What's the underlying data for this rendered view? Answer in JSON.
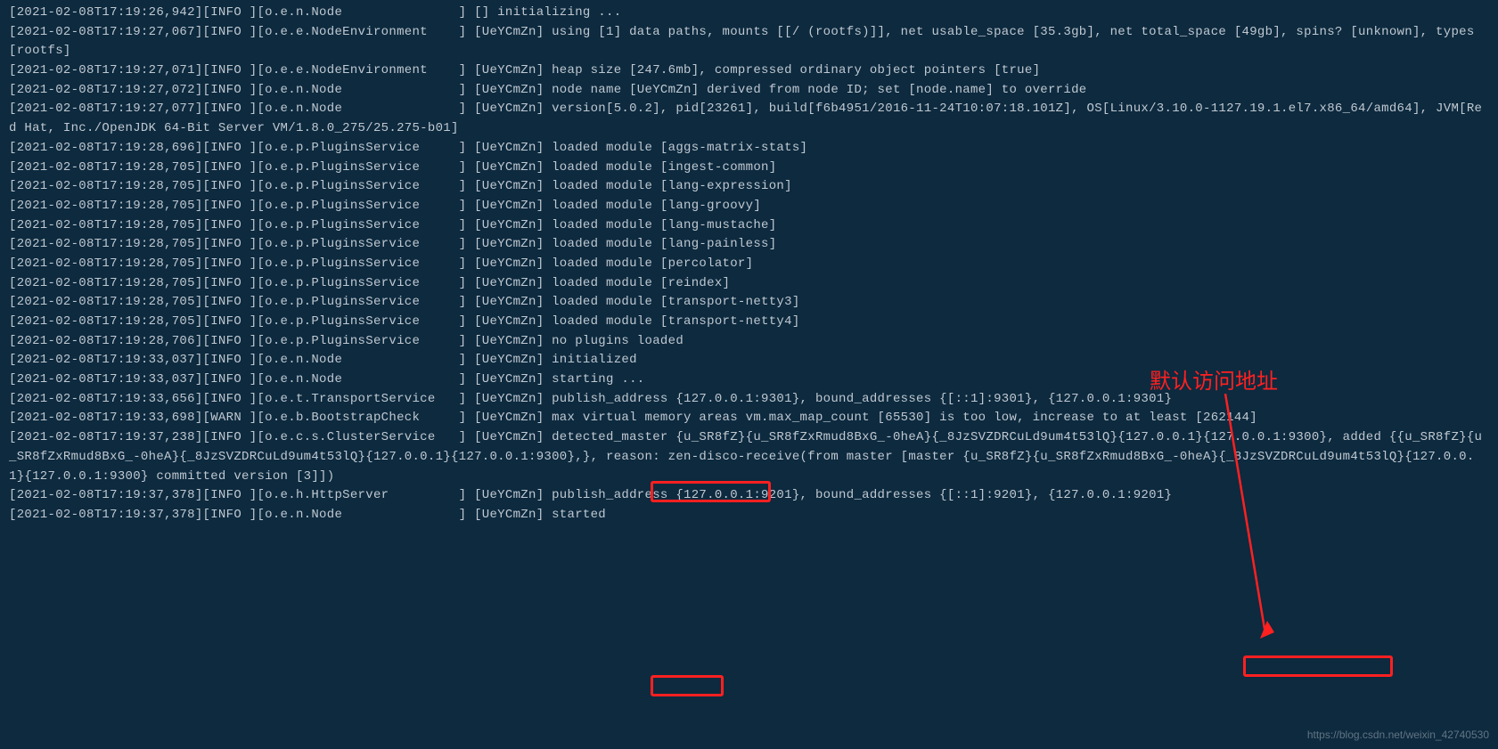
{
  "log_lines": [
    "[2021-02-08T17:19:26,942][INFO ][o.e.n.Node               ] [] initializing ...",
    "[2021-02-08T17:19:27,067][INFO ][o.e.e.NodeEnvironment    ] [UeYCmZn] using [1] data paths, mounts [[/ (rootfs)]], net usable_space [35.3gb], net total_space [49gb], spins? [unknown], types [rootfs]",
    "[2021-02-08T17:19:27,071][INFO ][o.e.e.NodeEnvironment    ] [UeYCmZn] heap size [247.6mb], compressed ordinary object pointers [true]",
    "[2021-02-08T17:19:27,072][INFO ][o.e.n.Node               ] [UeYCmZn] node name [UeYCmZn] derived from node ID; set [node.name] to override",
    "[2021-02-08T17:19:27,077][INFO ][o.e.n.Node               ] [UeYCmZn] version[5.0.2], pid[23261], build[f6b4951/2016-11-24T10:07:18.101Z], OS[Linux/3.10.0-1127.19.1.el7.x86_64/amd64], JVM[Red Hat, Inc./OpenJDK 64-Bit Server VM/1.8.0_275/25.275-b01]",
    "[2021-02-08T17:19:28,696][INFO ][o.e.p.PluginsService     ] [UeYCmZn] loaded module [aggs-matrix-stats]",
    "[2021-02-08T17:19:28,705][INFO ][o.e.p.PluginsService     ] [UeYCmZn] loaded module [ingest-common]",
    "[2021-02-08T17:19:28,705][INFO ][o.e.p.PluginsService     ] [UeYCmZn] loaded module [lang-expression]",
    "[2021-02-08T17:19:28,705][INFO ][o.e.p.PluginsService     ] [UeYCmZn] loaded module [lang-groovy]",
    "[2021-02-08T17:19:28,705][INFO ][o.e.p.PluginsService     ] [UeYCmZn] loaded module [lang-mustache]",
    "[2021-02-08T17:19:28,705][INFO ][o.e.p.PluginsService     ] [UeYCmZn] loaded module [lang-painless]",
    "[2021-02-08T17:19:28,705][INFO ][o.e.p.PluginsService     ] [UeYCmZn] loaded module [percolator]",
    "[2021-02-08T17:19:28,705][INFO ][o.e.p.PluginsService     ] [UeYCmZn] loaded module [reindex]",
    "[2021-02-08T17:19:28,705][INFO ][o.e.p.PluginsService     ] [UeYCmZn] loaded module [transport-netty3]",
    "[2021-02-08T17:19:28,705][INFO ][o.e.p.PluginsService     ] [UeYCmZn] loaded module [transport-netty4]",
    "[2021-02-08T17:19:28,706][INFO ][o.e.p.PluginsService     ] [UeYCmZn] no plugins loaded",
    "[2021-02-08T17:19:33,037][INFO ][o.e.n.Node               ] [UeYCmZn] initialized",
    "[2021-02-08T17:19:33,037][INFO ][o.e.n.Node               ] [UeYCmZn] starting ...",
    "[2021-02-08T17:19:33,656][INFO ][o.e.t.TransportService   ] [UeYCmZn] publish_address {127.0.0.1:9301}, bound_addresses {[::1]:9301}, {127.0.0.1:9301}",
    "[2021-02-08T17:19:33,698][WARN ][o.e.b.BootstrapCheck     ] [UeYCmZn] max virtual memory areas vm.max_map_count [65530] is too low, increase to at least [262144]",
    "[2021-02-08T17:19:37,238][INFO ][o.e.c.s.ClusterService   ] [UeYCmZn] detected_master {u_SR8fZ}{u_SR8fZxRmud8BxG_-0heA}{_8JzSVZDRCuLd9um4t53lQ}{127.0.0.1}{127.0.0.1:9300}, added {{u_SR8fZ}{u_SR8fZxRmud8BxG_-0heA}{_8JzSVZDRCuLd9um4t53lQ}{127.0.0.1}{127.0.0.1:9300},}, reason: zen-disco-receive(from master [master {u_SR8fZ}{u_SR8fZxRmud8BxG_-0heA}{_8JzSVZDRCuLd9um4t53lQ}{127.0.0.1}{127.0.0.1:9300} committed version [3]])",
    "[2021-02-08T17:19:37,378][INFO ][o.e.h.HttpServer         ] [UeYCmZn] publish_address {127.0.0.1:9201}, bound_addresses {[::1]:9201}, {127.0.0.1:9201}",
    "[2021-02-08T17:19:37,378][INFO ][o.e.n.Node               ] [UeYCmZn] started"
  ],
  "annotation": {
    "label": "默认访问地址"
  },
  "watermark": "https://blog.csdn.net/weixin_42740530"
}
